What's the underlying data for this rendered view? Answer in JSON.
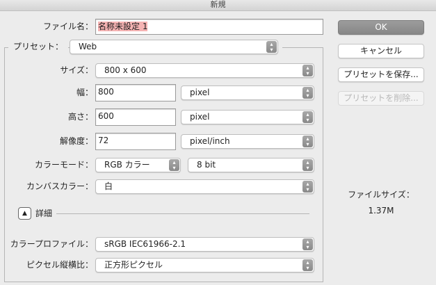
{
  "window": {
    "title": "新規"
  },
  "file_name": {
    "label": "ファイル名：",
    "value": "名称未設定 1"
  },
  "preset": {
    "label": "プリセット：",
    "value": "Web"
  },
  "size": {
    "label": "サイズ：",
    "value": "800 x 600"
  },
  "width": {
    "label": "幅：",
    "value": "800",
    "unit": "pixel"
  },
  "height": {
    "label": "高さ：",
    "value": "600",
    "unit": "pixel"
  },
  "resolution": {
    "label": "解像度：",
    "value": "72",
    "unit": "pixel/inch"
  },
  "color_mode": {
    "label": "カラーモード：",
    "value": "RGB カラー",
    "bits": "8 bit"
  },
  "canvas_color": {
    "label": "カンバスカラー：",
    "value": "白"
  },
  "details": {
    "label": "詳細"
  },
  "color_profile": {
    "label": "カラープロファイル：",
    "value": "sRGB IEC61966-2.1"
  },
  "pixel_aspect": {
    "label": "ピクセル縦横比：",
    "value": "正方形ピクセル"
  },
  "buttons": {
    "ok": "OK",
    "cancel": "キャンセル",
    "save_preset": "プリセットを保存...",
    "delete_preset": "プリセットを削除..."
  },
  "file_size": {
    "label": "ファイルサイズ：",
    "value": "1.37M"
  }
}
